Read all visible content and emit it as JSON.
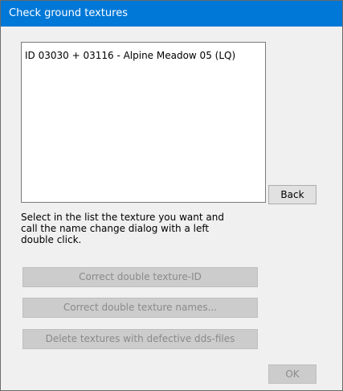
{
  "window": {
    "title": "Check ground textures"
  },
  "texture_list": {
    "items": [
      "ID 03030 + 03116  -  Alpine Meadow 05 (LQ)"
    ]
  },
  "buttons": {
    "back": "Back",
    "correct_double_id": "Correct double texture-ID",
    "correct_double_names": "Correct double texture names...",
    "delete_defective": "Delete textures with defective dds-files",
    "ok": "OK"
  },
  "instruction": {
    "lines": [
      "Select in the list the texture you want and",
      "call the name change dialog with a left",
      "double click."
    ]
  },
  "colors": {
    "titlebar": "#0078d7",
    "dialog_bg": "#f0f0f0",
    "disabled_text": "#8a8a8a"
  }
}
